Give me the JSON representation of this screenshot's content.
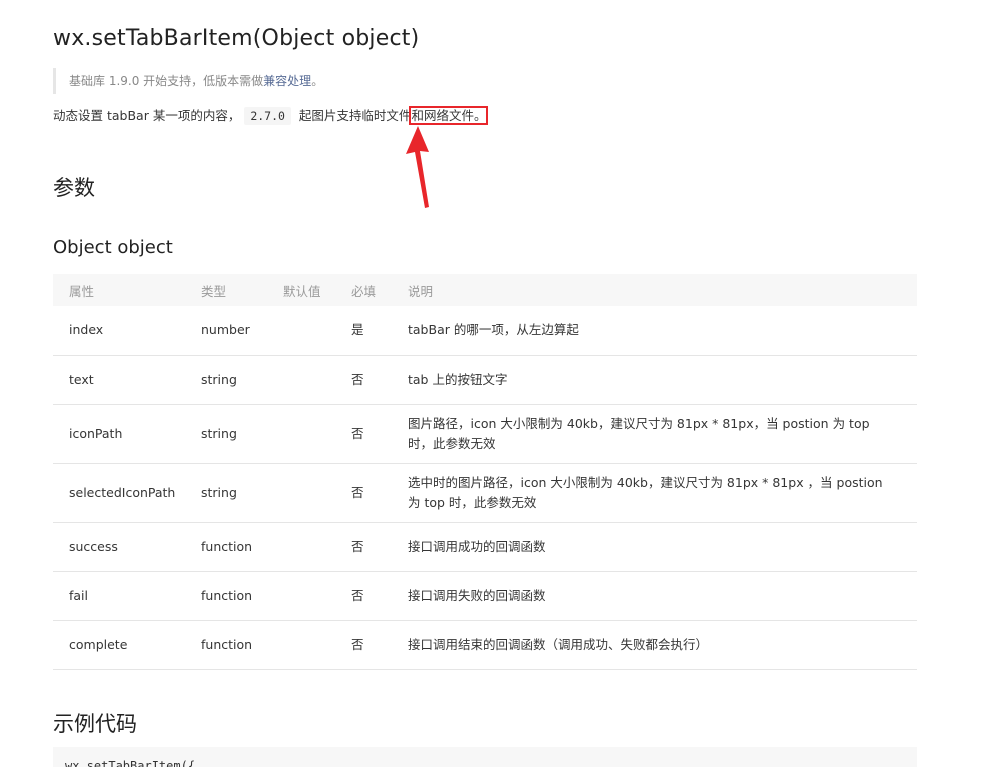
{
  "title": "wx.setTabBarItem(Object object)",
  "note": {
    "prefix": "基础库 1.9.0 开始支持，低版本需做",
    "link": "兼容处理",
    "suffix": "。"
  },
  "intro": {
    "part1": "动态设置 tabBar 某一项的内容，",
    "version": "2.7.0",
    "part2": " 起图片支持临时文件",
    "highlight": "和网络文件。"
  },
  "params_heading": "参数",
  "object_heading": "Object object",
  "table": {
    "headers": [
      "属性",
      "类型",
      "默认值",
      "必填",
      "说明"
    ],
    "rows": [
      {
        "attr": "index",
        "type": "number",
        "default": "",
        "required": "是",
        "desc": "tabBar 的哪一项，从左边算起"
      },
      {
        "attr": "text",
        "type": "string",
        "default": "",
        "required": "否",
        "desc": "tab 上的按钮文字"
      },
      {
        "attr": "iconPath",
        "type": "string",
        "default": "",
        "required": "否",
        "desc": "图片路径，icon 大小限制为 40kb，建议尺寸为 81px * 81px，当 postion 为 top 时，此参数无效"
      },
      {
        "attr": "selectedIconPath",
        "type": "string",
        "default": "",
        "required": "否",
        "desc": "选中时的图片路径，icon 大小限制为 40kb，建议尺寸为 81px * 81px ，当 postion 为 top 时，此参数无效"
      },
      {
        "attr": "success",
        "type": "function",
        "default": "",
        "required": "否",
        "desc": "接口调用成功的回调函数"
      },
      {
        "attr": "fail",
        "type": "function",
        "default": "",
        "required": "否",
        "desc": "接口调用失败的回调函数"
      },
      {
        "attr": "complete",
        "type": "function",
        "default": "",
        "required": "否",
        "desc": "接口调用结束的回调函数（调用成功、失败都会执行）"
      }
    ]
  },
  "example_heading": "示例代码",
  "code_first_line": "wx.setTabBarItem({",
  "colors": {
    "annotation": "#e8262b",
    "link": "#576b95"
  }
}
